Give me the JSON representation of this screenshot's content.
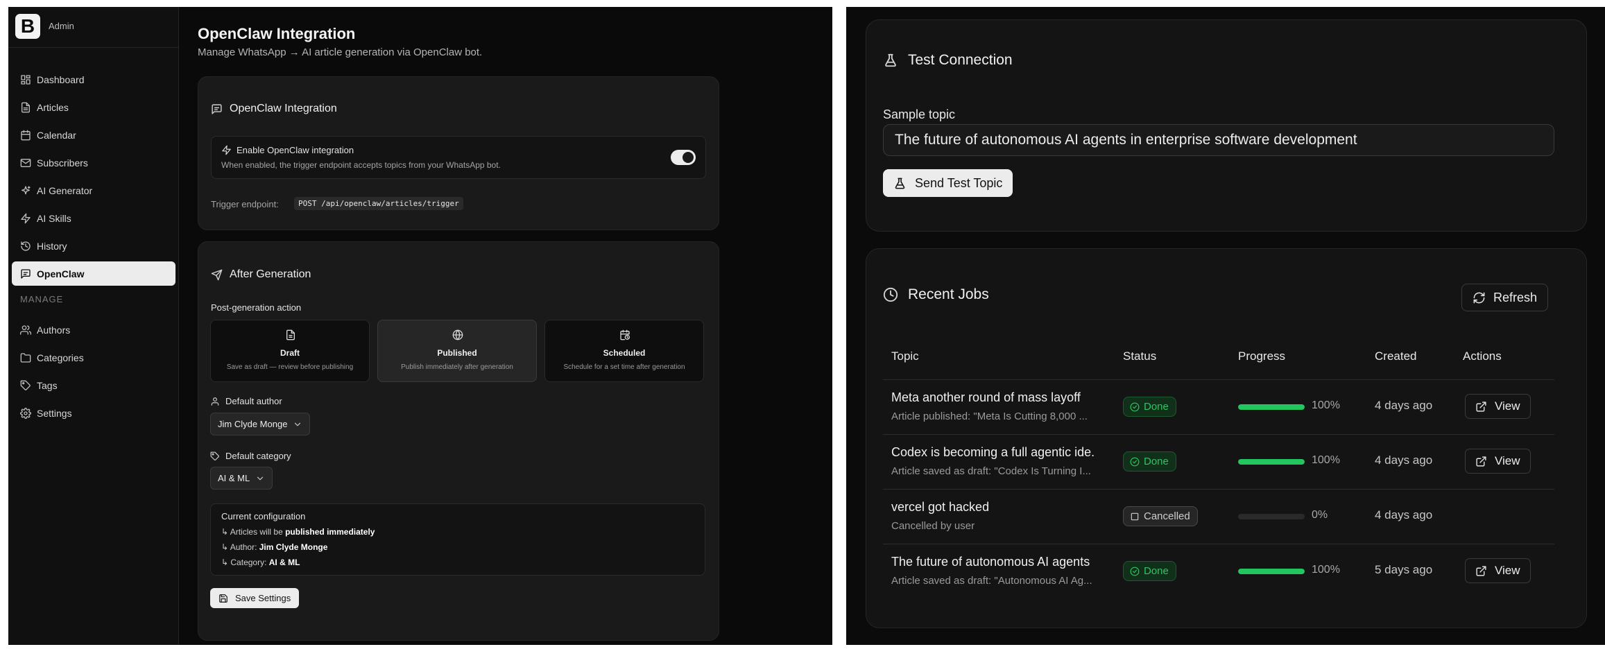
{
  "sidebar": {
    "brand_letter": "B",
    "brand_name": "Admin",
    "items": [
      {
        "label": "Dashboard",
        "icon": "dashboard-icon"
      },
      {
        "label": "Articles",
        "icon": "file-text-icon"
      },
      {
        "label": "Calendar",
        "icon": "calendar-icon"
      },
      {
        "label": "Subscribers",
        "icon": "mail-icon"
      },
      {
        "label": "AI Generator",
        "icon": "sparkles-icon"
      },
      {
        "label": "AI Skills",
        "icon": "zap-icon"
      },
      {
        "label": "History",
        "icon": "history-icon"
      },
      {
        "label": "OpenClaw",
        "icon": "message-square-icon",
        "active": true
      }
    ],
    "section_label": "MANAGE",
    "manage_items": [
      {
        "label": "Authors",
        "icon": "users-icon"
      },
      {
        "label": "Categories",
        "icon": "folder-icon"
      },
      {
        "label": "Tags",
        "icon": "tag-icon"
      },
      {
        "label": "Settings",
        "icon": "gear-icon"
      }
    ]
  },
  "page": {
    "title": "OpenClaw Integration",
    "subtitle": "Manage WhatsApp → AI article generation via OpenClaw bot."
  },
  "integration": {
    "card_title": "OpenClaw Integration",
    "enable_label": "Enable OpenClaw integration",
    "enable_desc": "When enabled, the trigger endpoint accepts topics from your WhatsApp bot.",
    "enabled": true,
    "trigger_label": "Trigger endpoint:",
    "trigger_value": "POST /api/openclaw/articles/trigger"
  },
  "after": {
    "card_title": "After Generation",
    "action_label": "Post-generation action",
    "options": [
      {
        "title": "Draft",
        "desc": "Save as draft — review before publishing",
        "icon": "file-icon"
      },
      {
        "title": "Published",
        "desc": "Publish immediately after generation",
        "icon": "globe-icon",
        "selected": true
      },
      {
        "title": "Scheduled",
        "desc": "Schedule for a set time after generation",
        "icon": "calendar-clock-icon"
      }
    ],
    "author_label": "Default author",
    "author_value": "Jim Clyde Monge",
    "category_label": "Default category",
    "category_value": "AI & ML",
    "config_title": "Current configuration",
    "config_prefix_1": "↳ Articles will be ",
    "config_value_1": "published immediately",
    "config_prefix_2": "↳ Author: ",
    "config_value_2": "Jim Clyde Monge",
    "config_prefix_3": "↳ Category: ",
    "config_value_3": "AI & ML",
    "save_label": "Save Settings"
  },
  "test": {
    "title": "Test Connection",
    "sample_label": "Sample topic",
    "sample_value": "The future of autonomous AI agents in enterprise software development",
    "send_label": "Send Test Topic"
  },
  "jobs": {
    "title": "Recent Jobs",
    "refresh_label": "Refresh",
    "columns": [
      "Topic",
      "Status",
      "Progress",
      "Created",
      "Actions"
    ],
    "rows": [
      {
        "topic": "Meta another round of mass layoff",
        "sub": "Article published: \"Meta Is Cutting 8,000 ...",
        "status": "Done",
        "progress": 100,
        "progress_label": "100%",
        "created": "4 days ago",
        "action": "View"
      },
      {
        "topic": "Codex is becoming a full agentic ide.",
        "sub": "Article saved as draft: \"Codex Is Turning I...",
        "status": "Done",
        "progress": 100,
        "progress_label": "100%",
        "created": "4 days ago",
        "action": "View"
      },
      {
        "topic": "vercel got hacked",
        "sub": "Cancelled by user",
        "status": "Cancelled",
        "progress": 0,
        "progress_label": "0%",
        "created": "4 days ago",
        "action": ""
      },
      {
        "topic": "The future of autonomous AI agents",
        "sub": "Article saved as draft: \"Autonomous AI Ag...",
        "status": "Done",
        "progress": 100,
        "progress_label": "100%",
        "created": "5 days ago",
        "action": "View"
      }
    ]
  },
  "colors": {
    "accent_green": "#22c55e",
    "background": "#0a0a0a",
    "card": "#1a1a1a"
  }
}
